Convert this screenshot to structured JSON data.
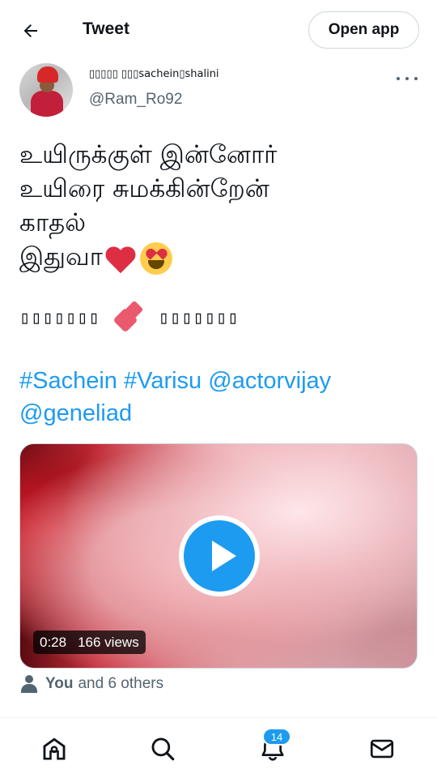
{
  "header": {
    "title": "Tweet",
    "open_app_label": "Open app"
  },
  "author": {
    "display_name": "▯▯▯▯▯ ▯▯▯sachein▯shalini",
    "handle": "@Ram_Ro92"
  },
  "tweet": {
    "lines": [
      "உயிருக்குள் இன்னோர்",
      "உயிரை சுமக்கின்றேன்",
      "காதல்",
      "இதுவா"
    ],
    "emojis": [
      "red-heart",
      "smiling-face-with-heart-eyes",
      "revolving-hearts"
    ],
    "secondary_left": "▯▯▯▯▯▯▯",
    "secondary_right": "▯▯▯▯▯▯▯",
    "hashtags": [
      "#Sachein",
      "#Varisu"
    ],
    "mentions": [
      "@actorvijay",
      "@geneliad"
    ]
  },
  "video": {
    "duration": "0:28",
    "views": "166 views"
  },
  "likes": {
    "you": "You",
    "others": "and 6 others"
  },
  "tabbar": {
    "items": [
      "home-icon",
      "search-icon",
      "notifications-icon",
      "messages-icon"
    ],
    "notification_count": "14"
  },
  "colors": {
    "accent": "#1d9bf0",
    "text": "#0f1419",
    "secondary_text": "#536471",
    "heart": "#dd2e44"
  }
}
